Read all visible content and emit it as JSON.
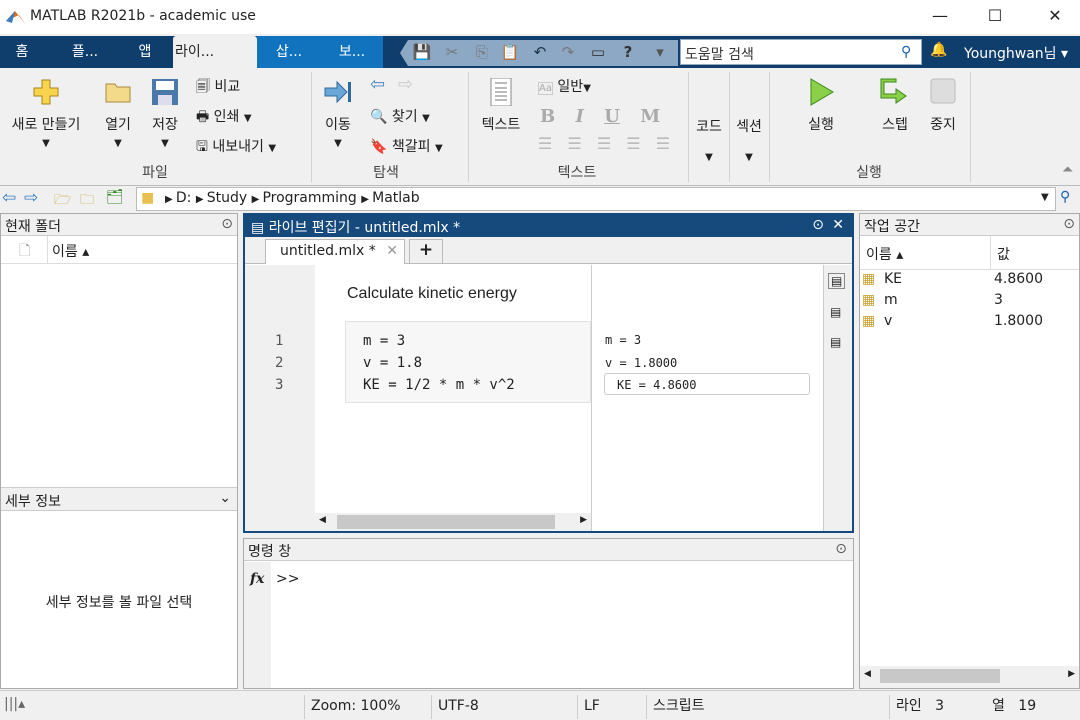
{
  "window": {
    "title": "MATLAB R2021b - academic use",
    "minimize": "—",
    "maximize": "☐",
    "close": "✕"
  },
  "tabs": [
    "홈",
    "플...",
    "앱",
    "라이...",
    "삽...",
    "보..."
  ],
  "search": {
    "placeholder": "도움말 검색"
  },
  "user": "Younghwan님 ▾",
  "ribbon": {
    "file": {
      "new": "새로 만들기",
      "open": "열기",
      "save": "저장",
      "compare": "비교",
      "print": "인쇄",
      "export": "내보내기",
      "group": "파일"
    },
    "nav": {
      "goto": "이동",
      "find": "찾기",
      "bookmark": "책갈피",
      "group": "탐색"
    },
    "text": {
      "text": "텍스트",
      "style": "일반",
      "bold": "B",
      "italic": "I",
      "underline": "U",
      "mono": "M",
      "group": "텍스트"
    },
    "code": "코드",
    "section": "섹션",
    "run": {
      "run": "실행",
      "step": "스텝",
      "stop": "중지",
      "group": "실행"
    }
  },
  "address": {
    "path": [
      "D:",
      "Study",
      "Programming",
      "Matlab"
    ]
  },
  "current_folder": {
    "title": "현재 폴더",
    "col_name": "이름 ▴"
  },
  "details": {
    "title": "세부 정보",
    "empty": "세부 정보를 볼 파일 선택"
  },
  "live_editor": {
    "title": "라이브 편집기 - untitled.mlx *",
    "tab": "untitled.mlx *",
    "heading": "Calculate kinetic energy",
    "lines": [
      {
        "n": "1",
        "code": "m = 3"
      },
      {
        "n": "2",
        "code": "v = 1.8"
      },
      {
        "n": "3",
        "code": "KE = 1/2 * m * v^2"
      }
    ],
    "outputs": [
      "m = 3",
      "v = 1.8000",
      "KE = 4.8600"
    ]
  },
  "command_window": {
    "title": "명령 창",
    "fx": "fx",
    "prompt": ">>"
  },
  "workspace": {
    "title": "작업 공간",
    "col_name": "이름 ▴",
    "col_value": "값",
    "vars": [
      {
        "name": "KE",
        "value": "4.8600"
      },
      {
        "name": "m",
        "value": "3"
      },
      {
        "name": "v",
        "value": "1.8000"
      }
    ]
  },
  "status": {
    "zoom": "Zoom: 100%",
    "encoding": "UTF-8",
    "eol": "LF",
    "type": "스크립트",
    "line_label": "라인",
    "line": "3",
    "col_label": "열",
    "col": "19"
  }
}
